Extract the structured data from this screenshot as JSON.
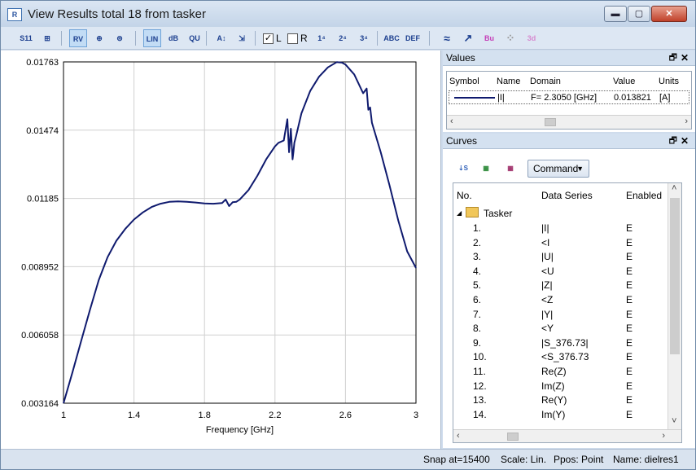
{
  "window": {
    "title": "View Results total 18 from tasker",
    "min_label": "▬",
    "max_label": "▢",
    "close_label": "✕"
  },
  "toolbar": {
    "buttons": [
      {
        "name": "s11-button",
        "label": "S11"
      },
      {
        "name": "split-button",
        "label": "⊞"
      },
      {
        "name": "zoom-fit-button",
        "label": "RV"
      },
      {
        "name": "polar-button",
        "label": "⊕"
      },
      {
        "name": "smith-button",
        "label": "⊜"
      },
      {
        "name": "lin-button",
        "label": "LIN"
      },
      {
        "name": "db-button",
        "label": "dB"
      },
      {
        "name": "qu-button",
        "label": "QU"
      },
      {
        "name": "axis-a-button",
        "label": "A↕"
      },
      {
        "name": "axis-fit-button",
        "label": "⇲"
      },
      {
        "name": "marker1-button",
        "label": "1⁴"
      },
      {
        "name": "marker2-button",
        "label": "2⁴"
      },
      {
        "name": "marker3-button",
        "label": "3⁴"
      },
      {
        "name": "marker-abc-button",
        "label": "ABC"
      },
      {
        "name": "marker-def-button",
        "label": "DEF"
      },
      {
        "name": "wave-button",
        "label": "≈"
      },
      {
        "name": "export-button",
        "label": "↗"
      },
      {
        "name": "bus-button",
        "label": "Bu"
      },
      {
        "name": "dots-button",
        "label": "⁘"
      },
      {
        "name": "3d-button",
        "label": "3d"
      }
    ],
    "check_l": {
      "label": "L",
      "checked": "✓"
    },
    "check_r": {
      "label": "R",
      "checked": ""
    }
  },
  "chart_data": {
    "type": "line",
    "title": "",
    "xlabel": "Frequency [GHz]",
    "ylabel": "",
    "xlim": [
      1,
      3
    ],
    "ylim": [
      0.003164,
      0.01763
    ],
    "x_ticks": [
      "1",
      "1.4",
      "1.8",
      "2.2",
      "2.6",
      "3"
    ],
    "y_ticks": [
      "0.01763",
      "0.01474",
      "0.01185",
      "0.008952",
      "0.006058",
      "0.003164"
    ],
    "grid": true,
    "series": [
      {
        "name": "|I|",
        "color": "#0f1a6e",
        "x": [
          1.0,
          1.05,
          1.1,
          1.15,
          1.2,
          1.25,
          1.3,
          1.35,
          1.4,
          1.45,
          1.5,
          1.55,
          1.6,
          1.65,
          1.7,
          1.75,
          1.8,
          1.85,
          1.9,
          1.92,
          1.94,
          1.96,
          1.98,
          2.0,
          2.05,
          2.1,
          2.15,
          2.2,
          2.22,
          2.25,
          2.27,
          2.28,
          2.29,
          2.3,
          2.305,
          2.31,
          2.32,
          2.35,
          2.4,
          2.45,
          2.5,
          2.55,
          2.58,
          2.6,
          2.65,
          2.7,
          2.72,
          2.73,
          2.74,
          2.75,
          2.78,
          2.8,
          2.85,
          2.9,
          2.95,
          3.0
        ],
        "y": [
          0.00316,
          0.00445,
          0.0058,
          0.00712,
          0.00838,
          0.00935,
          0.01005,
          0.01055,
          0.01095,
          0.01125,
          0.01148,
          0.01162,
          0.0117,
          0.01172,
          0.0117,
          0.01167,
          0.01163,
          0.01162,
          0.01165,
          0.0118,
          0.01152,
          0.01168,
          0.0117,
          0.0118,
          0.0122,
          0.0128,
          0.0135,
          0.01405,
          0.0142,
          0.0143,
          0.0152,
          0.0138,
          0.0148,
          0.0135,
          0.01382,
          0.0142,
          0.0145,
          0.01545,
          0.0164,
          0.017,
          0.0174,
          0.01762,
          0.0176,
          0.01752,
          0.0171,
          0.0163,
          0.0165,
          0.0156,
          0.0157,
          0.01505,
          0.0143,
          0.0138,
          0.0124,
          0.0109,
          0.0096,
          0.0089
        ]
      }
    ]
  },
  "values_panel": {
    "title": "Values",
    "columns": [
      "Symbol",
      "Name",
      "Domain",
      "Value",
      "Units"
    ],
    "row": {
      "name": "|I|",
      "domain": "F=  2.3050 [GHz]",
      "value": "0.013821",
      "units": "[A]"
    },
    "pin": "🗗",
    "close": "✕"
  },
  "curves_panel": {
    "title": "Curves",
    "command_label": "Command",
    "columns": [
      "No.",
      "Data Series",
      "Enabled"
    ],
    "group": "Tasker",
    "rows": [
      {
        "no": "1.",
        "series": "|I|",
        "enabled": "E"
      },
      {
        "no": "2.",
        "series": "<I",
        "enabled": "E"
      },
      {
        "no": "3.",
        "series": "|U|",
        "enabled": "E"
      },
      {
        "no": "4.",
        "series": "<U",
        "enabled": "E"
      },
      {
        "no": "5.",
        "series": "|Z|",
        "enabled": "E"
      },
      {
        "no": "6.",
        "series": "<Z",
        "enabled": "E"
      },
      {
        "no": "7.",
        "series": "|Y|",
        "enabled": "E"
      },
      {
        "no": "8.",
        "series": "<Y",
        "enabled": "E"
      },
      {
        "no": "9.",
        "series": "|S_376.73|",
        "enabled": "E"
      },
      {
        "no": "10.",
        "series": "<S_376.73",
        "enabled": "E"
      },
      {
        "no": "11.",
        "series": "Re(Z)",
        "enabled": "E"
      },
      {
        "no": "12.",
        "series": "Im(Z)",
        "enabled": "E"
      },
      {
        "no": "13.",
        "series": "Re(Y)",
        "enabled": "E"
      },
      {
        "no": "14.",
        "series": "Im(Y)",
        "enabled": "E"
      }
    ],
    "pin": "🗗",
    "close": "✕"
  },
  "status": {
    "snap": "Snap at=15400",
    "scale": "Scale: Lin.",
    "ppos": "Ppos: Point",
    "name": "Name: dielres1"
  }
}
